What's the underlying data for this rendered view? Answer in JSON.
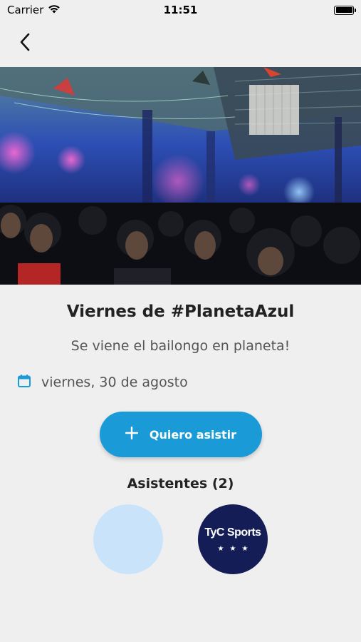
{
  "status_bar": {
    "carrier": "Carrier",
    "time": "11:51"
  },
  "nav": {
    "back_icon": "chevron-left-icon"
  },
  "event": {
    "title": "Viernes de #PlanetaAzul",
    "subtitle": "Se viene el bailongo en planeta!",
    "date": "viernes, 30 de agosto",
    "date_icon": "calendar-icon"
  },
  "actions": {
    "attend_label": "Quiero asistir",
    "attend_icon": "plus-icon"
  },
  "attendees": {
    "heading": "Asistentes (2)",
    "items": [
      {
        "avatar_color": "#c9e3fb"
      },
      {
        "avatar_color": "#151d57",
        "logo_text": "TyC Sports",
        "logo_stars": "★★★"
      }
    ]
  },
  "colors": {
    "accent": "#1a9ad6",
    "background": "#efefef"
  }
}
